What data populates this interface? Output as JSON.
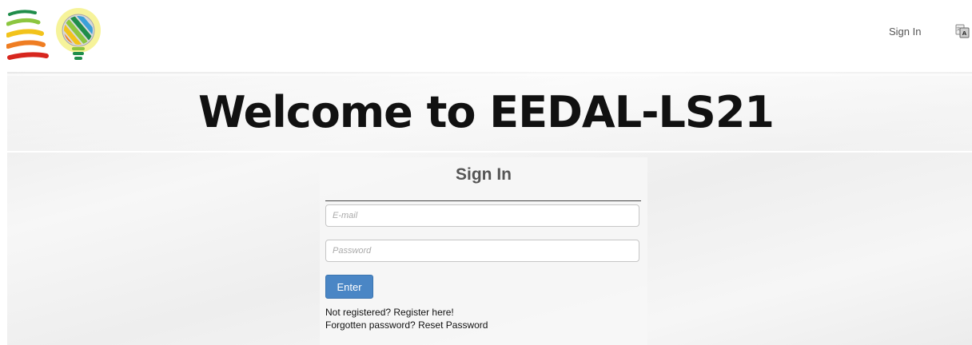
{
  "navbar": {
    "sign_in_link": "Sign In",
    "language_icon": "language-translate-icon"
  },
  "banner": {
    "title": "Welcome to EEDAL-LS21"
  },
  "signin": {
    "title": "Sign In",
    "email_placeholder": "E-mail",
    "password_placeholder": "Password",
    "enter_label": "Enter",
    "register_prompt": "Not registered?",
    "register_link": "Register here!",
    "forgot_prompt": "Forgotten password?",
    "reset_link": "Reset Password"
  },
  "colors": {
    "primary_button": "#4a86c5",
    "logo_bulb_glow": "#f3f07a",
    "logo_stripes": [
      "#1f8d4a",
      "#8cc63f",
      "#f2c31b",
      "#ef7d22",
      "#d7261e"
    ]
  }
}
